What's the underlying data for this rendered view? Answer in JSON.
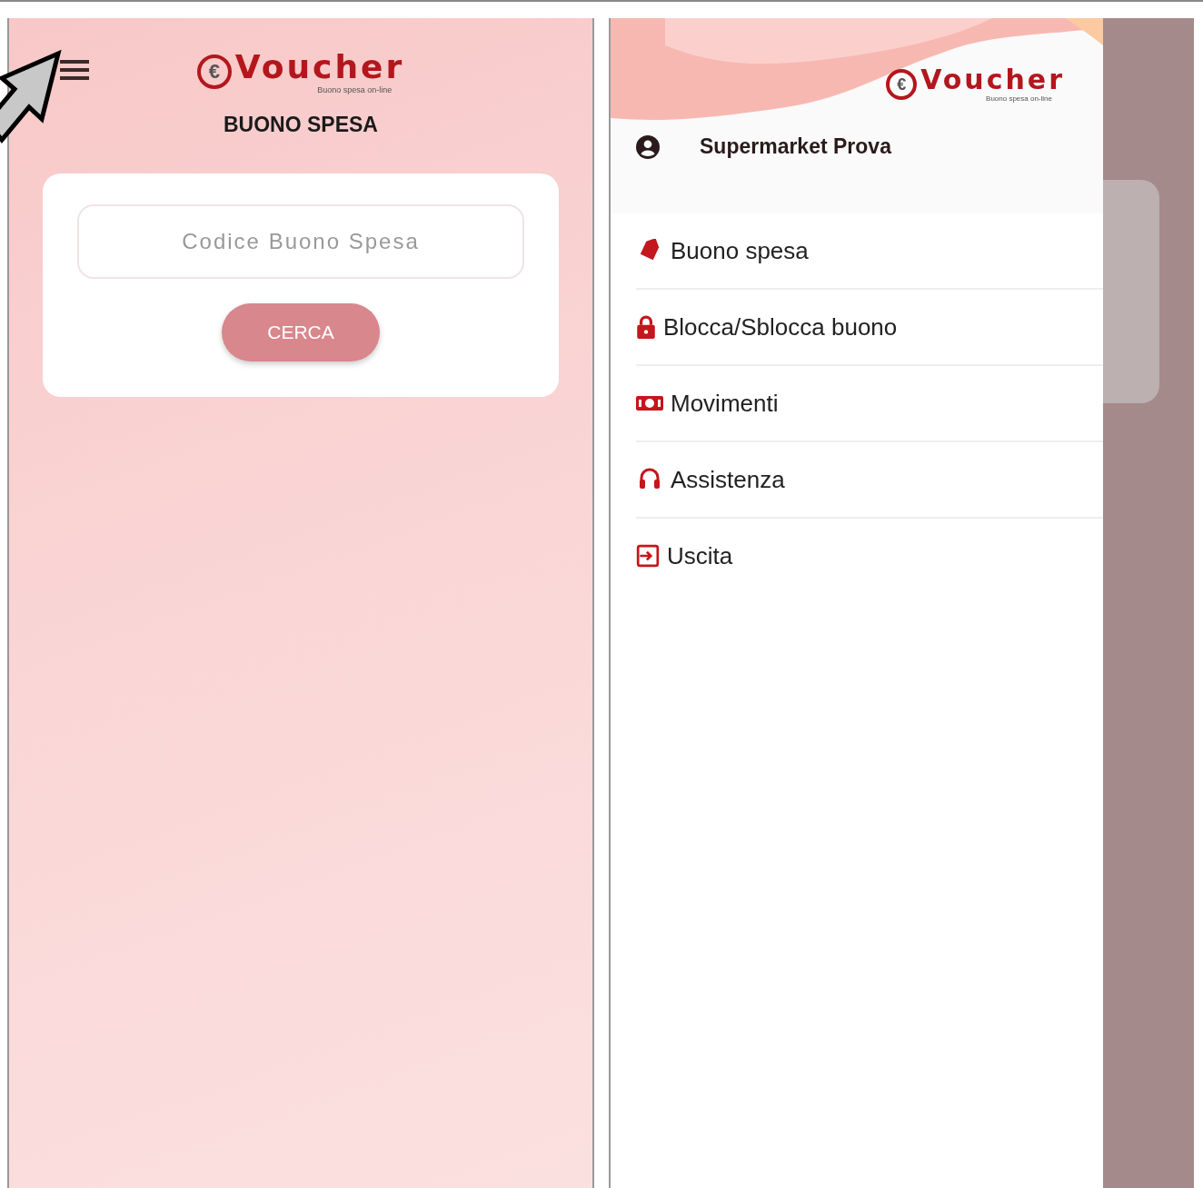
{
  "app_screen": {
    "logo": {
      "symbol": "€",
      "name": "Voucher",
      "tagline": "Buono spesa on-line"
    },
    "title": "BUONO SPESA",
    "search_card": {
      "code_field": {
        "placeholder": "Codice Buono Spesa"
      },
      "search_button": "CERCA"
    }
  },
  "drawer": {
    "logo": {
      "symbol": "€",
      "name": "Voucher",
      "tagline": "Buono spesa on-line"
    },
    "user": {
      "name": "Supermarket Prova"
    },
    "items": [
      {
        "kind": "tag",
        "label": "Buono spesa"
      },
      {
        "kind": "lock",
        "label": "Blocca/Sblocca buono"
      },
      {
        "kind": "money",
        "label": "Movimenti"
      },
      {
        "kind": "headset",
        "label": "Assistenza"
      },
      {
        "kind": "exit",
        "label": "Uscita"
      }
    ]
  }
}
